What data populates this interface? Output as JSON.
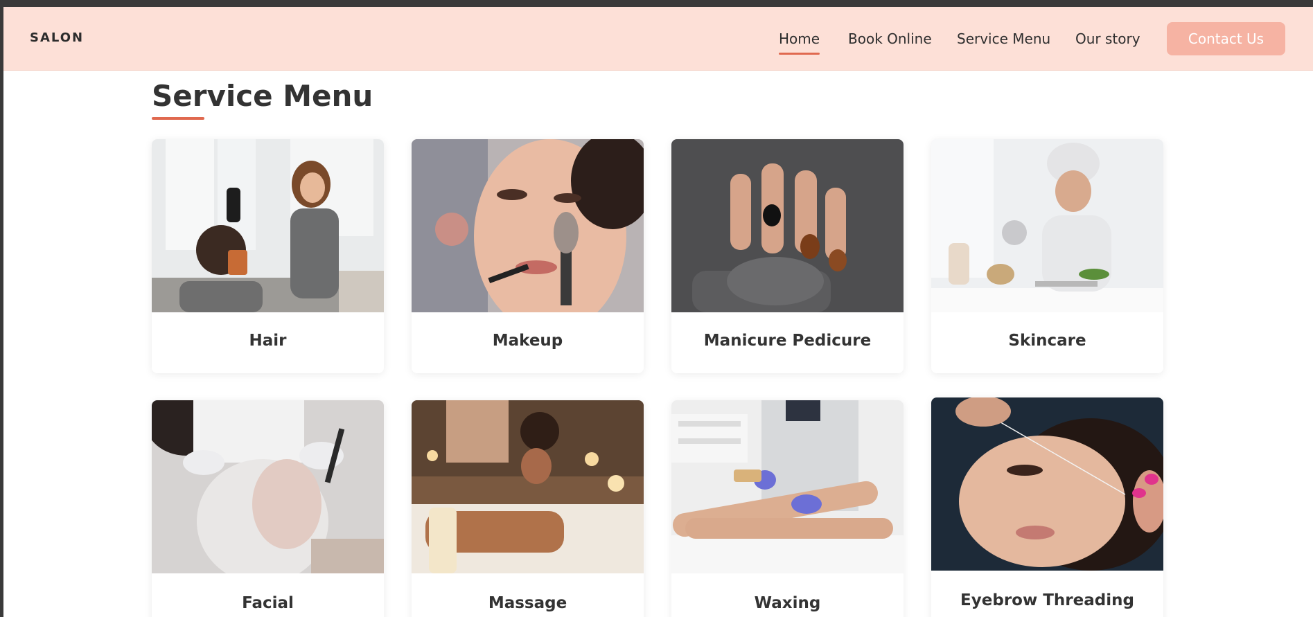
{
  "nav": {
    "brand": "SALON",
    "links": [
      "Home",
      "Book Online",
      "Service Menu",
      "Our story"
    ],
    "active": "Home",
    "contact_label": "Contact Us"
  },
  "main": {
    "title": "Service Menu",
    "services": [
      {
        "label": "Hair"
      },
      {
        "label": "Makeup"
      },
      {
        "label": "Manicure Pedicure"
      },
      {
        "label": "Skincare"
      },
      {
        "label": "Facial"
      },
      {
        "label": "Massage"
      },
      {
        "label": "Waxing"
      },
      {
        "label": "Eyebrow Threading"
      }
    ]
  },
  "colors": {
    "nav_bg": "#fde0d7",
    "accent": "#e0694f",
    "button_bg": "#f6b3a3"
  }
}
